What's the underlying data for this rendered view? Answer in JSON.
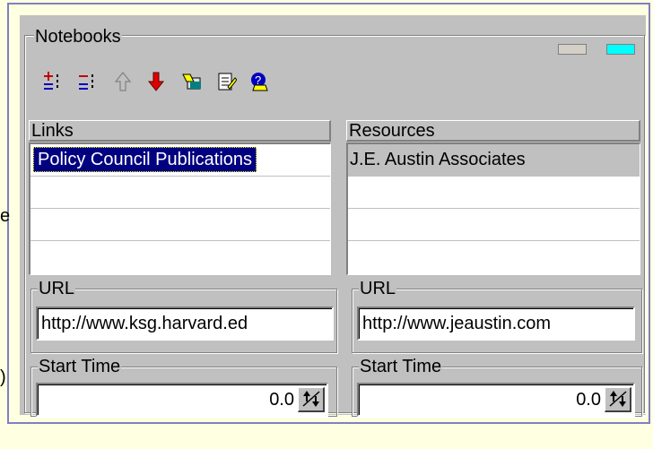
{
  "notebooks": {
    "title": "Notebooks",
    "toolbar": [
      "add-link-icon",
      "remove-link-icon",
      "move-up-icon",
      "move-down-icon",
      "open-notebook-icon",
      "edit-notebook-icon",
      "help-notebook-icon"
    ]
  },
  "links": {
    "header": "Links",
    "items": [
      "Policy Council Publications",
      "",
      ""
    ],
    "url_label": "URL",
    "url_value": "http://www.ksg.harvard.ed",
    "start_label": "Start Time",
    "start_value": "0.0"
  },
  "resources": {
    "header": "Resources",
    "items": [
      "J.E. Austin Associates",
      "",
      ""
    ],
    "url_label": "URL",
    "url_value": "http://www.jeaustin.com",
    "start_label": "Start Time",
    "start_value": "0.0"
  },
  "edge_text": {
    "left_e": "e",
    "left_paren": ")"
  },
  "colors": {
    "selection": "#000080",
    "accent_toggle": "#00ffff",
    "panel": "#c0c0c0"
  }
}
